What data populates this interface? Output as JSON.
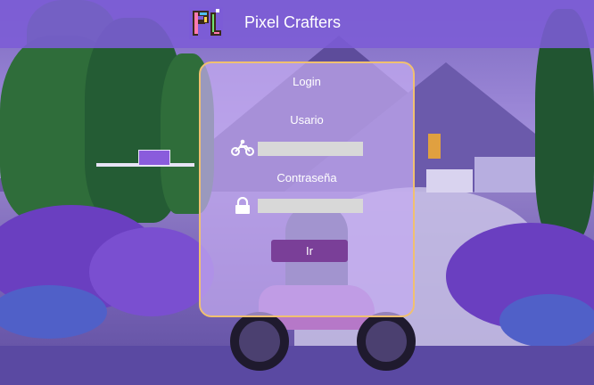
{
  "header": {
    "title": "Pixel Crafters",
    "logo_icon": "pixel-crafters-logo"
  },
  "login": {
    "title": "Login",
    "user_label": "Usario",
    "user_value": "",
    "password_label": "Contraseña",
    "password_value": "",
    "submit_label": "Ir"
  },
  "icons": {
    "user": "motorcycle-icon",
    "password": "lock-icon"
  },
  "colors": {
    "header": "#7c5cd6",
    "card_border": "#f0c070",
    "button": "#7a3f98",
    "field": "#d8d8d8"
  }
}
